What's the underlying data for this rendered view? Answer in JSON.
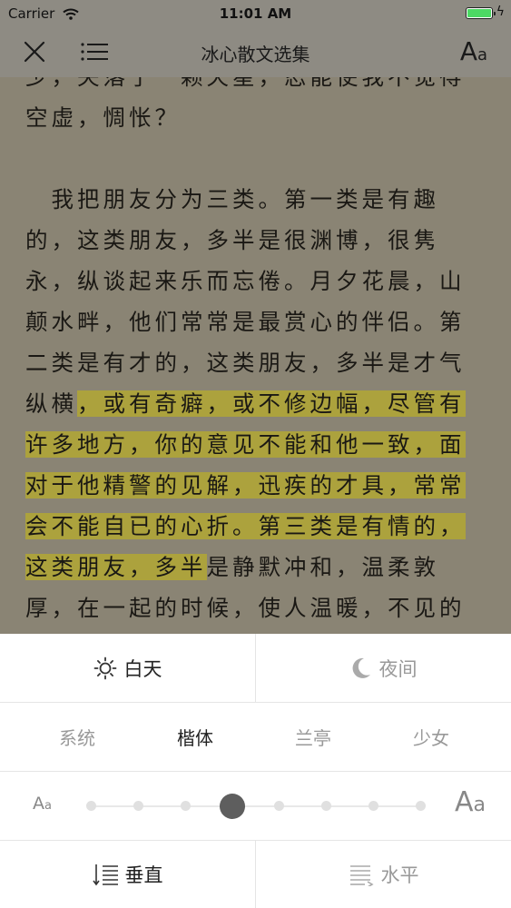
{
  "status_bar": {
    "carrier": "Carrier",
    "time": "11:01 AM"
  },
  "toolbar": {
    "title": "冰心散文选集",
    "font_big": "A",
    "font_small": "a"
  },
  "reader": {
    "lines": [
      [
        {
          "t": "少，失落了一颗天星，忍能使我不觉得",
          "h": false
        }
      ],
      [
        {
          "t": "空虚，惆怅？",
          "h": false
        }
      ],
      [
        {
          "t": "",
          "h": false
        }
      ],
      [
        {
          "t": "　我把朋友分为三类。第一类是有趣",
          "h": false
        }
      ],
      [
        {
          "t": "的，这类朋友，多半是很渊博，很隽",
          "h": false
        }
      ],
      [
        {
          "t": "永，纵谈起来乐而忘倦。月夕花晨，山",
          "h": false
        }
      ],
      [
        {
          "t": "颠水畔，他们常常是最赏心的伴侣。第",
          "h": false
        }
      ],
      [
        {
          "t": "二类是有才的，这类朋友，多半是才气",
          "h": false
        }
      ],
      [
        {
          "t": "纵横",
          "h": false
        },
        {
          "t": "，或有奇癖，或不修边幅，尽管有",
          "h": true
        }
      ],
      [
        {
          "t": "许多地方，你的意见不能和他一致，面",
          "h": true
        }
      ],
      [
        {
          "t": "对于他精警的见解，迅疾的才具，常常",
          "h": true
        }
      ],
      [
        {
          "t": "会不能自已的心折。第三类是有情的，",
          "h": true
        }
      ],
      [
        {
          "t": "这类朋友，多半",
          "h": true
        },
        {
          "t": "是静默冲和，温柔敦",
          "h": false
        }
      ],
      [
        {
          "t": "厚，在一起的时候，使人温暖，不见的",
          "h": false
        }
      ]
    ]
  },
  "panel": {
    "day_label": "白天",
    "night_label": "夜间",
    "fonts": [
      "系统",
      "楷体",
      "兰亭",
      "少女"
    ],
    "active_font": "楷体",
    "size_small_a1": "A",
    "size_small_a2": "a",
    "size_large_a1": "A",
    "size_large_a2": "a",
    "font_size_steps": 8,
    "font_size_selected_step": 4,
    "vertical_label": "垂直",
    "horizontal_label": "水平"
  },
  "colors": {
    "highlight": "#aca23d",
    "overlay": "#8e8b83",
    "battery": "#4cd964"
  }
}
